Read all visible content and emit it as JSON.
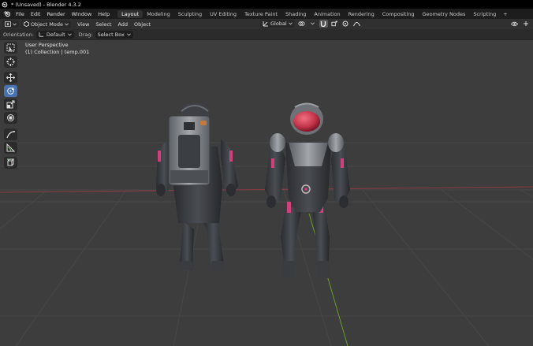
{
  "window": {
    "title": "* (Unsaved) - Blender 4.3.2"
  },
  "menu": {
    "items": [
      "File",
      "Edit",
      "Render",
      "Window",
      "Help"
    ],
    "workspaces": [
      "Layout",
      "Modeling",
      "Sculpting",
      "UV Editing",
      "Texture Paint",
      "Shading",
      "Animation",
      "Rendering",
      "Compositing",
      "Geometry Nodes",
      "Scripting"
    ],
    "active_workspace": "Layout",
    "add_workspace": "+"
  },
  "header": {
    "mode": "Object Mode",
    "menus": [
      "View",
      "Select",
      "Add",
      "Object"
    ],
    "transform_orientation": "Global"
  },
  "tool_settings": {
    "orientation_label": "Orientation:",
    "orientation_value": "Default",
    "drag_label": "Drag:",
    "drag_value": "Select Box"
  },
  "viewport": {
    "perspective": "User Perspective",
    "collection_info": "(1) Collection | temp.001"
  },
  "toolbar": {
    "tools": [
      "select-box",
      "cursor",
      "move",
      "rotate",
      "scale",
      "transform",
      "annotate",
      "measure",
      "add-cube"
    ],
    "active_tool": "rotate"
  },
  "colors": {
    "accent": "#4772b3",
    "x_axis": "#8b3a46",
    "y_axis": "#6b9a2a",
    "helmet_visor": "#c4344a",
    "suit_trim": "#d0407a"
  }
}
